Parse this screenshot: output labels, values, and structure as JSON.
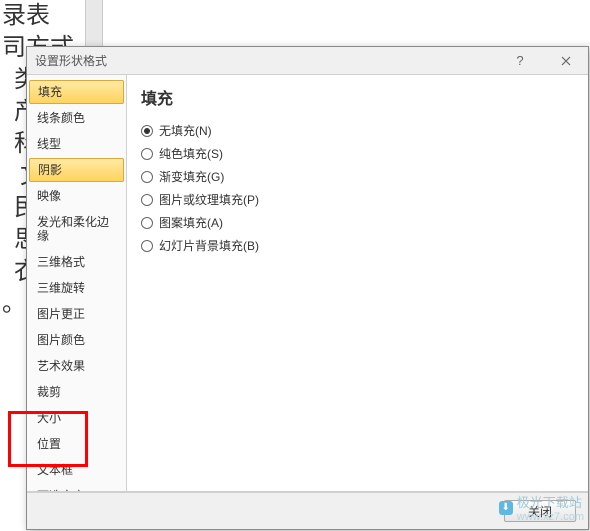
{
  "background": {
    "lines": [
      "录表",
      "司方式",
      "  类",
      "  产",
      "  科",
      "   文",
      "  民",
      "  思",
      "  衣",
      "。             可"
    ]
  },
  "dialog": {
    "title": "设置形状格式",
    "sidebar": {
      "items": [
        {
          "label": "填充",
          "selected": true
        },
        {
          "label": "线条颜色",
          "selected": false
        },
        {
          "label": "线型",
          "selected": false
        },
        {
          "label": "阴影",
          "selected": true
        },
        {
          "label": "映像",
          "selected": false
        },
        {
          "label": "发光和柔化边缘",
          "selected": false
        },
        {
          "label": "三维格式",
          "selected": false
        },
        {
          "label": "三维旋转",
          "selected": false
        },
        {
          "label": "图片更正",
          "selected": false
        },
        {
          "label": "图片颜色",
          "selected": false
        },
        {
          "label": "艺术效果",
          "selected": false
        },
        {
          "label": "裁剪",
          "selected": false
        },
        {
          "label": "大小",
          "selected": false
        },
        {
          "label": "位置",
          "selected": false
        },
        {
          "label": "文本框",
          "selected": false
        },
        {
          "label": "可选文字",
          "selected": false
        }
      ]
    },
    "content": {
      "heading": "填充",
      "options": [
        {
          "label": "无填充(N)",
          "checked": true
        },
        {
          "label": "纯色填充(S)",
          "checked": false
        },
        {
          "label": "渐变填充(G)",
          "checked": false
        },
        {
          "label": "图片或纹理填充(P)",
          "checked": false
        },
        {
          "label": "图案填充(A)",
          "checked": false
        },
        {
          "label": "幻灯片背景填充(B)",
          "checked": false
        }
      ]
    },
    "footer": {
      "close_label": "关闭"
    }
  },
  "watermark": {
    "text": "极光下载站",
    "url": "www.xz7.com"
  }
}
